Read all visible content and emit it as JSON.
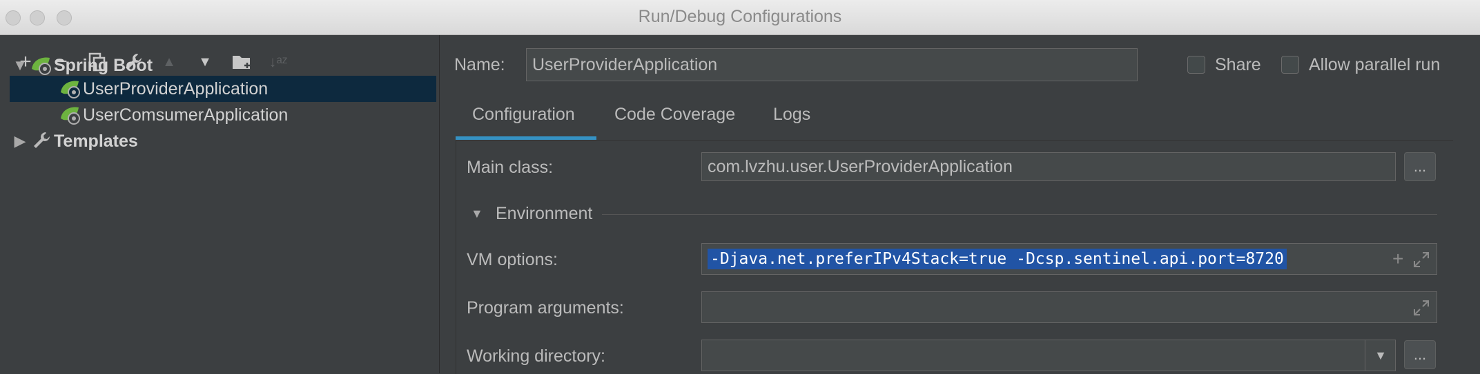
{
  "window": {
    "title": "Run/Debug Configurations"
  },
  "toolbar": {
    "add": "+",
    "remove": "−",
    "copy": "⧉",
    "edit": "🔧",
    "move_up": "▲",
    "move_down": "▼",
    "folder": "📁",
    "sort": "↓ᵃᶻ"
  },
  "tree": {
    "spring_boot": "Spring Boot",
    "items": [
      "UserProviderApplication",
      "UserComsumerApplication"
    ],
    "templates": "Templates"
  },
  "form": {
    "name_label": "Name:",
    "name_value": "UserProviderApplication",
    "share_label": "Share",
    "parallel_label": "Allow parallel run",
    "tabs": [
      "Configuration",
      "Code Coverage",
      "Logs"
    ],
    "main_class_label": "Main class:",
    "main_class_value": "com.lvzhu.user.UserProviderApplication",
    "browse": "...",
    "environment_label": "Environment",
    "vm_label": "VM options:",
    "vm_value": "-Djava.net.preferIPv4Stack=true -Dcsp.sentinel.api.port=8720",
    "program_args_label": "Program arguments:",
    "working_dir_label": "Working directory:"
  },
  "colors": {
    "accent": "#3592c4",
    "selection": "#0d293e",
    "text_selection": "#2154a5",
    "spring_green": "#6db33f"
  }
}
